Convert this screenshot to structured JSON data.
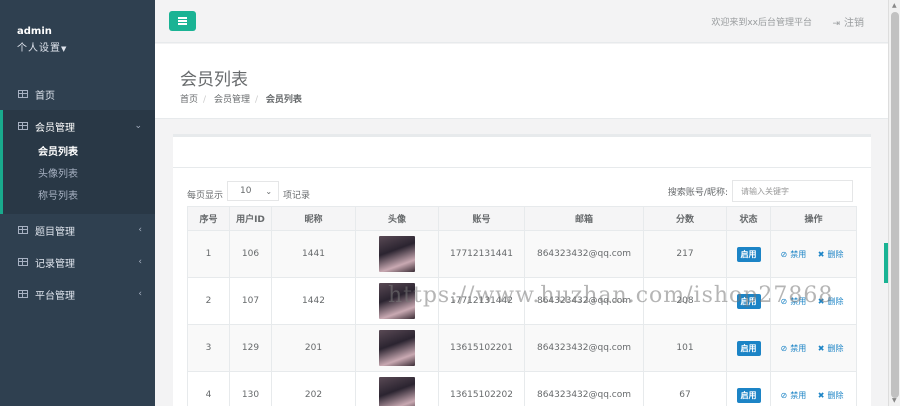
{
  "sidebar": {
    "user_name": "admin",
    "user_role": "个人设置",
    "items": [
      {
        "label": "首页"
      },
      {
        "label": "会员管理",
        "expanded": true,
        "children": [
          {
            "label": "会员列表",
            "current": true
          },
          {
            "label": "头像列表"
          },
          {
            "label": "称号列表"
          }
        ]
      },
      {
        "label": "题目管理"
      },
      {
        "label": "记录管理"
      },
      {
        "label": "平台管理"
      }
    ]
  },
  "topbar": {
    "welcome": "欢迎来到xx后台管理平台",
    "logout": "注销"
  },
  "page": {
    "title": "会员列表",
    "breadcrumb": [
      "首页",
      "会员管理",
      "会员列表"
    ]
  },
  "table_controls": {
    "length_prefix": "每页显示",
    "length_value": "10",
    "length_suffix": "项记录",
    "search_label": "搜索账号/昵称:",
    "search_placeholder": "请输入关键字"
  },
  "table": {
    "columns": [
      "序号",
      "用户ID",
      "昵称",
      "头像",
      "账号",
      "邮箱",
      "分数",
      "状态",
      "操作"
    ],
    "rows": [
      {
        "index": "1",
        "uid": "106",
        "nick": "1441",
        "account": "17712131441",
        "email": "864323432@qq.com",
        "score": "217",
        "status": "启用"
      },
      {
        "index": "2",
        "uid": "107",
        "nick": "1442",
        "account": "17712131442",
        "email": "864323432@qq.com",
        "score": "208",
        "status": "启用"
      },
      {
        "index": "3",
        "uid": "129",
        "nick": "201",
        "account": "13615102201",
        "email": "864323432@qq.com",
        "score": "101",
        "status": "启用"
      },
      {
        "index": "4",
        "uid": "130",
        "nick": "202",
        "account": "13615102202",
        "email": "864323432@qq.com",
        "score": "67",
        "status": "启用"
      }
    ],
    "action_disable": "禁用",
    "action_delete": "删除"
  },
  "watermark": "https://www.huzhan.com/ishop27868",
  "colors": {
    "sidebar": "#2f4050",
    "accent": "#1ab394",
    "primary": "#1c84c6"
  }
}
